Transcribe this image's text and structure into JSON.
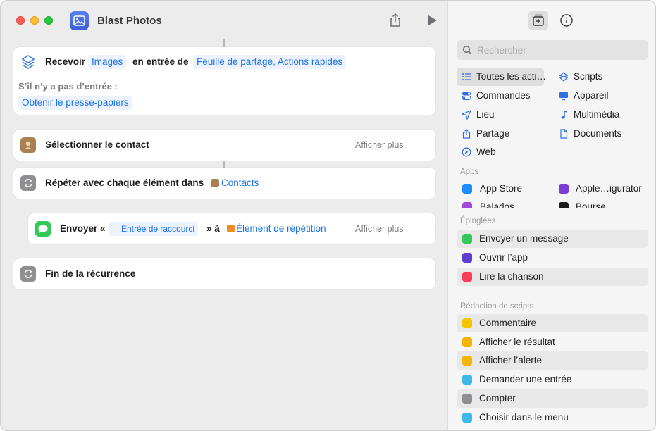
{
  "window": {
    "title": "Blast Photos"
  },
  "workflow": {
    "receive": {
      "verb": "Recevoir",
      "input_type": "Images",
      "from_text": "en entrée de",
      "sources": "Feuille de partage, Actions rapides",
      "no_input_label": "S’il n’y a pas d’entrée :",
      "fallback": "Obtenir le presse-papiers"
    },
    "select_contact": {
      "title": "Sélectionner le contact",
      "more": "Afficher plus"
    },
    "repeat": {
      "title": "Répéter avec chaque élément dans",
      "variable": "Contacts"
    },
    "send": {
      "verb": "Envoyer «",
      "content": "Entrée de raccourci",
      "to_text": "» à",
      "recipient": "Élément de répétition",
      "more": "Afficher plus"
    },
    "end_repeat": {
      "title": "Fin de la récurrence"
    }
  },
  "library": {
    "search_placeholder": "Rechercher",
    "categories": [
      {
        "label": "Toutes les acti…",
        "icon": "list-icon"
      },
      {
        "label": "Scripts",
        "icon": "scripts-icon"
      },
      {
        "label": "Commandes",
        "icon": "toggles-icon"
      },
      {
        "label": "Appareil",
        "icon": "display-icon"
      },
      {
        "label": "Lieu",
        "icon": "location-icon"
      },
      {
        "label": "Multimédia",
        "icon": "music-note-icon"
      },
      {
        "label": "Partage",
        "icon": "share-icon"
      },
      {
        "label": "Documents",
        "icon": "document-icon"
      },
      {
        "label": "Web",
        "icon": "compass-icon"
      }
    ],
    "apps_header": "Apps",
    "apps": [
      {
        "label": "App Store",
        "color": "#1c8ef9"
      },
      {
        "label": "Apple…igurator",
        "color": "#7a3fd0"
      },
      {
        "label": "Balados",
        "color": "#a348d8"
      },
      {
        "label": "Bourse",
        "color": "#1c1c1e"
      }
    ],
    "pinned_header": "Épinglées",
    "pinned": [
      {
        "label": "Envoyer un message",
        "color": "#34c759"
      },
      {
        "label": "Ouvrir l’app",
        "color": "#5e3fd1"
      },
      {
        "label": "Lire la chanson",
        "color": "#fb3c5a"
      }
    ],
    "scripting_header": "Rédaction de scripts",
    "scripting": [
      {
        "label": "Commentaire",
        "color": "#f5c400"
      },
      {
        "label": "Afficher le résultat",
        "color": "#f5b400"
      },
      {
        "label": "Afficher l’alerte",
        "color": "#f5b400"
      },
      {
        "label": "Demander une entrée",
        "color": "#3fb8e8"
      },
      {
        "label": "Compter",
        "color": "#8e8e93"
      },
      {
        "label": "Choisir dans le menu",
        "color": "#3fb8e8"
      }
    ]
  }
}
